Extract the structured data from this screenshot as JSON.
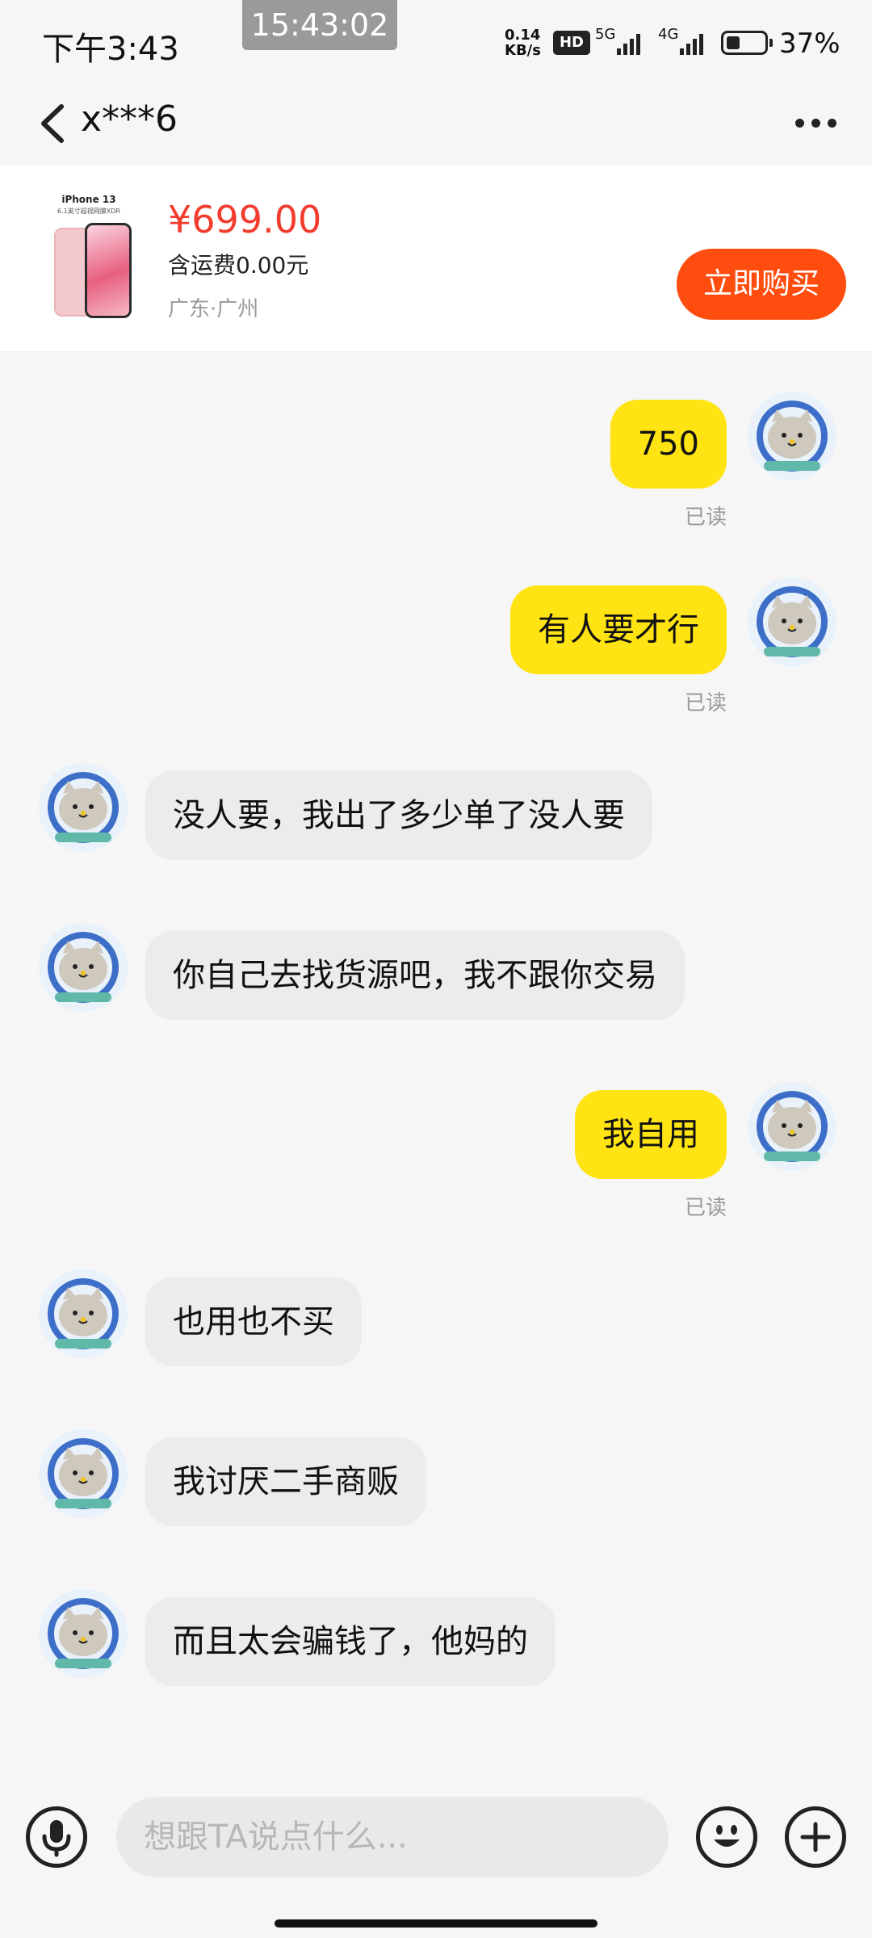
{
  "status_bar": {
    "time": "下午3:43",
    "screenshot_time": "15:43:02",
    "net_speed_value": "0.14",
    "net_speed_unit": "KB/s",
    "hd": "HD",
    "network_1": "5G",
    "network_2": "4G",
    "battery": "37%",
    "battery_level": 0.37
  },
  "header": {
    "contact_name": "x***6"
  },
  "product": {
    "image_title": "iPhone 13",
    "image_subtitle": "6.1英寸超视网膜XDR",
    "price": "¥699.00",
    "shipping": "含运费0.00元",
    "location": "广东·广州",
    "buy_label": "立即购买"
  },
  "messages": [
    {
      "side": "outgoing",
      "text": "750",
      "status": "已读"
    },
    {
      "side": "outgoing",
      "text": "有人要才行",
      "status": "已读"
    },
    {
      "side": "incoming",
      "text": "没人要，我出了多少单了没人要"
    },
    {
      "side": "incoming",
      "text": "你自己去找货源吧，我不跟你交易"
    },
    {
      "side": "outgoing",
      "text": "我自用",
      "status": "已读"
    },
    {
      "side": "incoming",
      "text": "也用也不买"
    },
    {
      "side": "incoming",
      "text": "我讨厌二手商贩"
    },
    {
      "side": "incoming",
      "text": "而且太会骗钱了，他妈的"
    }
  ],
  "input": {
    "placeholder": "想跟TA说点什么..."
  },
  "icons": {
    "back": "chevron-left-icon",
    "more": "more-dots-icon",
    "voice": "microphone-icon",
    "emoji": "emoji-icon",
    "add": "plus-icon"
  },
  "colors": {
    "outgoing_bubble": "#ffe313",
    "incoming_bubble": "#ececee",
    "price": "#f23c2e",
    "buy_button": "#ff4d0f"
  }
}
